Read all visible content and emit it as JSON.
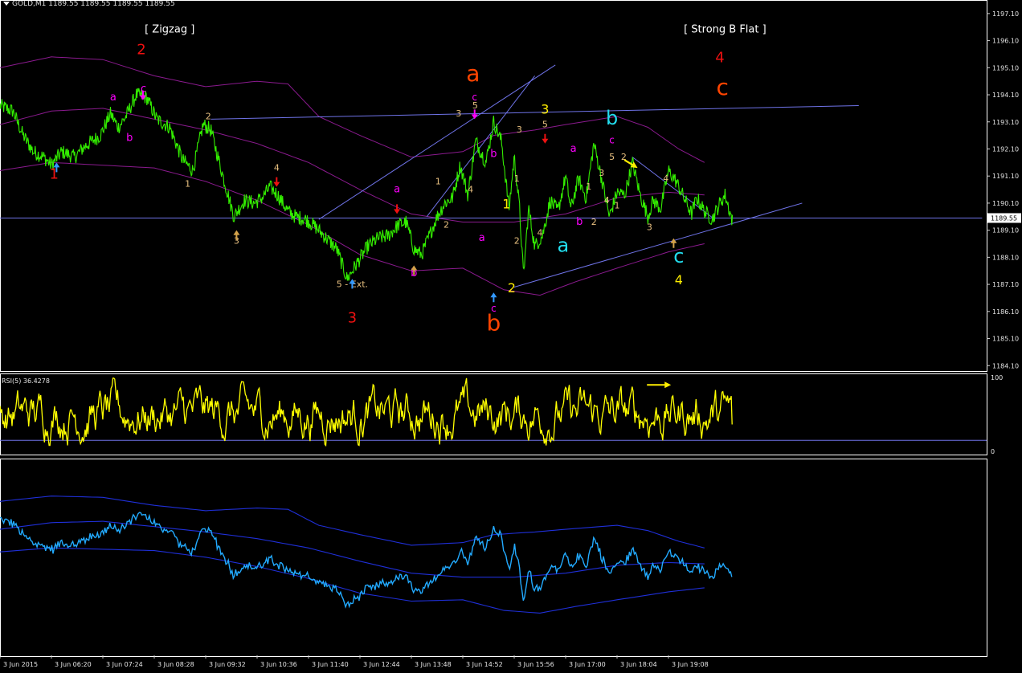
{
  "header": {
    "symbol_info": "GOLD,M1  1189.55 1189.55 1189.55 1189.55"
  },
  "colors": {
    "background": "#000000",
    "price": "#33ee00",
    "bands": "#8a1a8e",
    "trendlines": "#6f73e8",
    "rsi": "#ffff00",
    "indicator": "#22aaff",
    "indicator_bands": "#1f2fd8",
    "red": "#ee1111",
    "orange": "#ff4400",
    "magenta": "#ff00ff",
    "yellow": "#ffee00",
    "cyan": "#22ddee",
    "tan": "#e8c080",
    "arrow_orange": "#d4a24a",
    "arrow_blue": "#3399ff"
  },
  "chart_data": [
    {
      "type": "line",
      "panel": "main",
      "symbol": "GOLD,M1",
      "ylim": [
        1183.9,
        1197.6
      ],
      "y_ticks": [
        "1197.10",
        "1196.10",
        "1195.10",
        "1194.10",
        "1193.10",
        "1192.10",
        "1191.10",
        "1190.10",
        "1189.10",
        "1188.10",
        "1187.10",
        "1186.10",
        "1185.10",
        "1184.10"
      ],
      "current_price": "1189.55",
      "x_labels": [
        "3 Jun 2015",
        "3 Jun 06:20",
        "3 Jun 07:24",
        "3 Jun 08:28",
        "3 Jun 09:32",
        "3 Jun 10:36",
        "3 Jun 11:40",
        "3 Jun 12:44",
        "3 Jun 13:48",
        "3 Jun 14:52",
        "3 Jun 15:56",
        "3 Jun 17:00",
        "3 Jun 18:04",
        "3 Jun 19:08"
      ],
      "x_range": [
        0,
        13
      ],
      "price_anchors": [
        [
          0.0,
          1193.7
        ],
        [
          0.25,
          1193.5
        ],
        [
          0.45,
          1192.6
        ],
        [
          0.65,
          1192.0
        ],
        [
          0.85,
          1191.8
        ],
        [
          1.0,
          1191.5
        ],
        [
          1.2,
          1192.0
        ],
        [
          1.45,
          1191.8
        ],
        [
          1.65,
          1192.2
        ],
        [
          1.95,
          1192.6
        ],
        [
          2.15,
          1193.4
        ],
        [
          2.3,
          1192.9
        ],
        [
          2.45,
          1193.3
        ],
        [
          2.65,
          1194.1
        ],
        [
          2.85,
          1194.0
        ],
        [
          3.05,
          1193.2
        ],
        [
          3.3,
          1192.9
        ],
        [
          3.55,
          1191.7
        ],
        [
          3.75,
          1191.3
        ],
        [
          3.95,
          1193.0
        ],
        [
          4.1,
          1192.8
        ],
        [
          4.35,
          1191.0
        ],
        [
          4.55,
          1189.6
        ],
        [
          4.75,
          1190.2
        ],
        [
          4.95,
          1190.1
        ],
        [
          5.1,
          1190.3
        ],
        [
          5.25,
          1190.7
        ],
        [
          5.4,
          1190.4
        ],
        [
          5.6,
          1189.8
        ],
        [
          5.75,
          1189.6
        ],
        [
          5.95,
          1189.5
        ],
        [
          6.15,
          1189.2
        ],
        [
          6.35,
          1188.8
        ],
        [
          6.55,
          1188.4
        ],
        [
          6.75,
          1187.3
        ],
        [
          6.95,
          1187.9
        ],
        [
          7.15,
          1188.5
        ],
        [
          7.35,
          1188.8
        ],
        [
          7.55,
          1188.9
        ],
        [
          7.75,
          1189.3
        ],
        [
          7.9,
          1189.4
        ],
        [
          8.05,
          1188.4
        ],
        [
          8.2,
          1188.2
        ],
        [
          8.35,
          1188.9
        ],
        [
          8.5,
          1189.6
        ],
        [
          8.65,
          1190.1
        ],
        [
          8.8,
          1190.3
        ],
        [
          8.95,
          1191.5
        ],
        [
          9.1,
          1190.4
        ],
        [
          9.25,
          1192.4
        ],
        [
          9.45,
          1191.6
        ],
        [
          9.6,
          1193.1
        ],
        [
          9.75,
          1192.4
        ],
        [
          9.9,
          1189.9
        ],
        [
          10.0,
          1191.8
        ],
        [
          10.1,
          1190.0
        ],
        [
          10.18,
          1187.4
        ],
        [
          10.28,
          1189.9
        ],
        [
          10.4,
          1188.5
        ],
        [
          10.55,
          1188.9
        ],
        [
          10.7,
          1190.2
        ],
        [
          10.85,
          1189.8
        ],
        [
          11.0,
          1191.1
        ],
        [
          11.1,
          1189.9
        ],
        [
          11.25,
          1191.0
        ],
        [
          11.4,
          1190.3
        ],
        [
          11.55,
          1192.3
        ],
        [
          11.7,
          1191.0
        ],
        [
          11.85,
          1189.6
        ],
        [
          12.0,
          1190.5
        ],
        [
          12.15,
          1190.4
        ],
        [
          12.3,
          1191.6
        ],
        [
          12.45,
          1190.4
        ],
        [
          12.6,
          1189.6
        ],
        [
          12.7,
          1190.2
        ],
        [
          12.85,
          1189.9
        ],
        [
          13.0,
          1191.3
        ],
        [
          13.15,
          1190.9
        ],
        [
          13.3,
          1190.3
        ],
        [
          13.45,
          1189.7
        ],
        [
          13.55,
          1190.3
        ],
        [
          13.7,
          1189.8
        ],
        [
          13.85,
          1189.5
        ],
        [
          14.0,
          1190.1
        ],
        [
          14.1,
          1190.4
        ],
        [
          14.25,
          1189.4
        ]
      ],
      "band_upper": [
        [
          0.0,
          1195.1
        ],
        [
          1.0,
          1195.5
        ],
        [
          2.0,
          1195.4
        ],
        [
          3.0,
          1194.8
        ],
        [
          4.0,
          1194.4
        ],
        [
          5.0,
          1194.6
        ],
        [
          5.6,
          1194.5
        ],
        [
          6.2,
          1193.3
        ],
        [
          7.0,
          1192.6
        ],
        [
          8.0,
          1191.8
        ],
        [
          9.0,
          1192.0
        ],
        [
          9.6,
          1192.6
        ],
        [
          10.4,
          1192.8
        ],
        [
          11.0,
          1193.0
        ],
        [
          12.0,
          1193.3
        ],
        [
          12.6,
          1192.9
        ],
        [
          13.2,
          1192.1
        ],
        [
          13.7,
          1191.6
        ]
      ],
      "band_mid": [
        [
          0.0,
          1193.0
        ],
        [
          1.0,
          1193.5
        ],
        [
          2.0,
          1193.6
        ],
        [
          3.0,
          1193.2
        ],
        [
          4.0,
          1192.8
        ],
        [
          5.0,
          1192.3
        ],
        [
          6.0,
          1191.6
        ],
        [
          7.0,
          1190.6
        ],
        [
          8.0,
          1189.7
        ],
        [
          9.0,
          1189.4
        ],
        [
          10.0,
          1189.4
        ],
        [
          11.0,
          1189.7
        ],
        [
          12.0,
          1190.3
        ],
        [
          13.0,
          1190.5
        ],
        [
          13.7,
          1190.4
        ]
      ],
      "band_lower": [
        [
          0.0,
          1191.3
        ],
        [
          1.0,
          1191.6
        ],
        [
          2.0,
          1191.5
        ],
        [
          3.0,
          1191.4
        ],
        [
          4.0,
          1190.9
        ],
        [
          5.0,
          1190.2
        ],
        [
          6.0,
          1189.3
        ],
        [
          7.0,
          1188.2
        ],
        [
          8.0,
          1187.6
        ],
        [
          9.0,
          1187.7
        ],
        [
          9.8,
          1186.9
        ],
        [
          10.5,
          1186.7
        ],
        [
          11.2,
          1187.2
        ],
        [
          12.0,
          1187.7
        ],
        [
          13.0,
          1188.3
        ],
        [
          13.7,
          1188.6
        ]
      ],
      "trendlines": [
        [
          [
            4.1,
            1193.2
          ],
          [
            16.7,
            1193.7
          ]
        ],
        [
          [
            6.2,
            1189.5
          ],
          [
            10.8,
            1195.2
          ]
        ],
        [
          [
            8.3,
            1189.6
          ],
          [
            10.4,
            1194.8
          ]
        ],
        [
          [
            12.3,
            1191.8
          ],
          [
            13.9,
            1189.5
          ]
        ],
        [
          [
            10.0,
            1187.0
          ],
          [
            15.6,
            1190.1
          ]
        ],
        [
          [
            0.0,
            1189.55
          ],
          [
            19.1,
            1189.55
          ]
        ]
      ],
      "annotations": [
        {
          "x": 3.3,
          "y": 1196.4,
          "text": "[ Zigzag ]",
          "color": "#ffffff",
          "size": 13
        },
        {
          "x": 14.1,
          "y": 1196.4,
          "text": "[ Strong B Flat ]",
          "color": "#ffffff",
          "size": 13
        },
        {
          "x": 1.05,
          "y": 1191.0,
          "text": "1",
          "color": "red",
          "size": 18
        },
        {
          "x": 2.75,
          "y": 1195.6,
          "text": "2",
          "color": "red",
          "size": 18
        },
        {
          "x": 6.85,
          "y": 1185.7,
          "text": "3",
          "color": "red",
          "size": 18
        },
        {
          "x": 14.0,
          "y": 1195.3,
          "text": "4",
          "color": "red",
          "size": 18
        },
        {
          "x": 9.2,
          "y": 1194.6,
          "text": "a",
          "color": "orange",
          "size": 28
        },
        {
          "x": 9.6,
          "y": 1185.4,
          "text": "b",
          "color": "orange",
          "size": 28
        },
        {
          "x": 14.05,
          "y": 1194.1,
          "text": "c",
          "color": "orange",
          "size": 28
        },
        {
          "x": 2.2,
          "y": 1193.9,
          "text": "a",
          "color": "magenta",
          "size": 13
        },
        {
          "x": 2.52,
          "y": 1192.4,
          "text": "b",
          "color": "magenta",
          "size": 13
        },
        {
          "x": 2.79,
          "y": 1194.2,
          "text": "c",
          "color": "magenta",
          "size": 13
        },
        {
          "x": 7.72,
          "y": 1190.5,
          "text": "a",
          "color": "magenta",
          "size": 13
        },
        {
          "x": 8.05,
          "y": 1187.4,
          "text": "b",
          "color": "magenta",
          "size": 13
        },
        {
          "x": 9.23,
          "y": 1193.9,
          "text": "c",
          "color": "magenta",
          "size": 12
        },
        {
          "x": 9.6,
          "y": 1191.8,
          "text": "b",
          "color": "magenta",
          "size": 13
        },
        {
          "x": 9.37,
          "y": 1188.7,
          "text": "a",
          "color": "magenta",
          "size": 13
        },
        {
          "x": 9.6,
          "y": 1186.1,
          "text": "c",
          "color": "magenta",
          "size": 12
        },
        {
          "x": 11.15,
          "y": 1192.0,
          "text": "a",
          "color": "magenta",
          "size": 13
        },
        {
          "x": 11.27,
          "y": 1189.3,
          "text": "b",
          "color": "magenta",
          "size": 13
        },
        {
          "x": 11.9,
          "y": 1192.3,
          "text": "c",
          "color": "magenta",
          "size": 12
        },
        {
          "x": 4.05,
          "y": 1193.2,
          "text": "2",
          "color": "#e8c080",
          "size": 11
        },
        {
          "x": 3.65,
          "y": 1190.7,
          "text": "1",
          "color": "#e8c080",
          "size": 11
        },
        {
          "x": 4.6,
          "y": 1188.6,
          "text": "3",
          "color": "#e8c080",
          "size": 11
        },
        {
          "x": 5.38,
          "y": 1191.3,
          "text": "4",
          "color": "#e8c080",
          "size": 11
        },
        {
          "x": 6.85,
          "y": 1187.0,
          "text": "5 - Ext.",
          "color": "#e8c080",
          "size": 11
        },
        {
          "x": 8.52,
          "y": 1190.8,
          "text": "1",
          "color": "#e8c080",
          "size": 11
        },
        {
          "x": 8.68,
          "y": 1189.2,
          "text": "2",
          "color": "#e8c080",
          "size": 11
        },
        {
          "x": 8.92,
          "y": 1193.3,
          "text": "3",
          "color": "#e8c080",
          "size": 11
        },
        {
          "x": 9.15,
          "y": 1190.5,
          "text": "4",
          "color": "#e8c080",
          "size": 11
        },
        {
          "x": 9.24,
          "y": 1193.6,
          "text": "5",
          "color": "#e8c080",
          "size": 11
        },
        {
          "x": 9.85,
          "y": 1189.9,
          "text": "1",
          "color": "#ffee00",
          "size": 16
        },
        {
          "x": 9.95,
          "y": 1186.8,
          "text": "2",
          "color": "#ffee00",
          "size": 16
        },
        {
          "x": 10.6,
          "y": 1193.4,
          "text": "3",
          "color": "#ffee00",
          "size": 16
        },
        {
          "x": 13.2,
          "y": 1187.1,
          "text": "4",
          "color": "#ffee00",
          "size": 16
        },
        {
          "x": 10.1,
          "y": 1192.7,
          "text": "3",
          "color": "#e8c080",
          "size": 11
        },
        {
          "x": 10.05,
          "y": 1190.9,
          "text": "1",
          "color": "#e8c080",
          "size": 11
        },
        {
          "x": 10.05,
          "y": 1188.6,
          "text": "2",
          "color": "#e8c080",
          "size": 11
        },
        {
          "x": 10.5,
          "y": 1188.9,
          "text": "4",
          "color": "#e8c080",
          "size": 11
        },
        {
          "x": 10.6,
          "y": 1192.9,
          "text": "5",
          "color": "#e8c080",
          "size": 11
        },
        {
          "x": 11.45,
          "y": 1190.6,
          "text": "1",
          "color": "#e8c080",
          "size": 11
        },
        {
          "x": 11.55,
          "y": 1189.3,
          "text": "2",
          "color": "#e8c080",
          "size": 11
        },
        {
          "x": 11.7,
          "y": 1191.1,
          "text": "3",
          "color": "#e8c080",
          "size": 11
        },
        {
          "x": 11.8,
          "y": 1190.1,
          "text": "4",
          "color": "#e8c080",
          "size": 11
        },
        {
          "x": 11.9,
          "y": 1191.7,
          "text": "5",
          "color": "#e8c080",
          "size": 11
        },
        {
          "x": 12.13,
          "y": 1191.7,
          "text": "2",
          "color": "#e8c080",
          "size": 11
        },
        {
          "x": 12.0,
          "y": 1189.9,
          "text": "1",
          "color": "#e8c080",
          "size": 11
        },
        {
          "x": 12.63,
          "y": 1189.1,
          "text": "3",
          "color": "#e8c080",
          "size": 11
        },
        {
          "x": 12.95,
          "y": 1190.9,
          "text": "4",
          "color": "#e8c080",
          "size": 11
        },
        {
          "x": 10.95,
          "y": 1188.3,
          "text": "a",
          "color": "#22ddee",
          "size": 24
        },
        {
          "x": 11.9,
          "y": 1193.0,
          "text": "b",
          "color": "#22ddee",
          "size": 24
        },
        {
          "x": 13.2,
          "y": 1187.9,
          "text": "c",
          "color": "#22ddee",
          "size": 24
        }
      ],
      "arrows": [
        {
          "x": 1.1,
          "y": 1191.6,
          "dir": "up",
          "color": "blue"
        },
        {
          "x": 2.78,
          "y": 1193.9,
          "dir": "down",
          "color": "magenta"
        },
        {
          "x": 4.6,
          "y": 1189.1,
          "dir": "up",
          "color": "orange"
        },
        {
          "x": 5.38,
          "y": 1190.7,
          "dir": "down",
          "color": "red"
        },
        {
          "x": 6.85,
          "y": 1187.3,
          "dir": "up",
          "color": "blue"
        },
        {
          "x": 7.72,
          "y": 1189.7,
          "dir": "down",
          "color": "red"
        },
        {
          "x": 8.05,
          "y": 1187.8,
          "dir": "up",
          "color": "orange"
        },
        {
          "x": 9.23,
          "y": 1193.2,
          "dir": "down",
          "color": "magenta"
        },
        {
          "x": 9.6,
          "y": 1186.8,
          "dir": "up",
          "color": "blue"
        },
        {
          "x": 10.6,
          "y": 1192.3,
          "dir": "down",
          "color": "red"
        },
        {
          "x": 13.1,
          "y": 1188.8,
          "dir": "up",
          "color": "orange"
        },
        {
          "x": 12.4,
          "y": 1191.4,
          "dir": "right-down",
          "color": "yellow"
        }
      ]
    },
    {
      "type": "line",
      "panel": "rsi",
      "title": "RSI(5) 36.4278",
      "ylim": [
        0,
        100
      ],
      "y_ticks": [
        "100",
        "0"
      ],
      "levels": [
        15
      ],
      "last_value": 36.4278,
      "arrow": {
        "x": 12.55,
        "y": 90,
        "dir": "right",
        "color": "yellow"
      }
    },
    {
      "type": "line",
      "panel": "indicator"
    }
  ]
}
